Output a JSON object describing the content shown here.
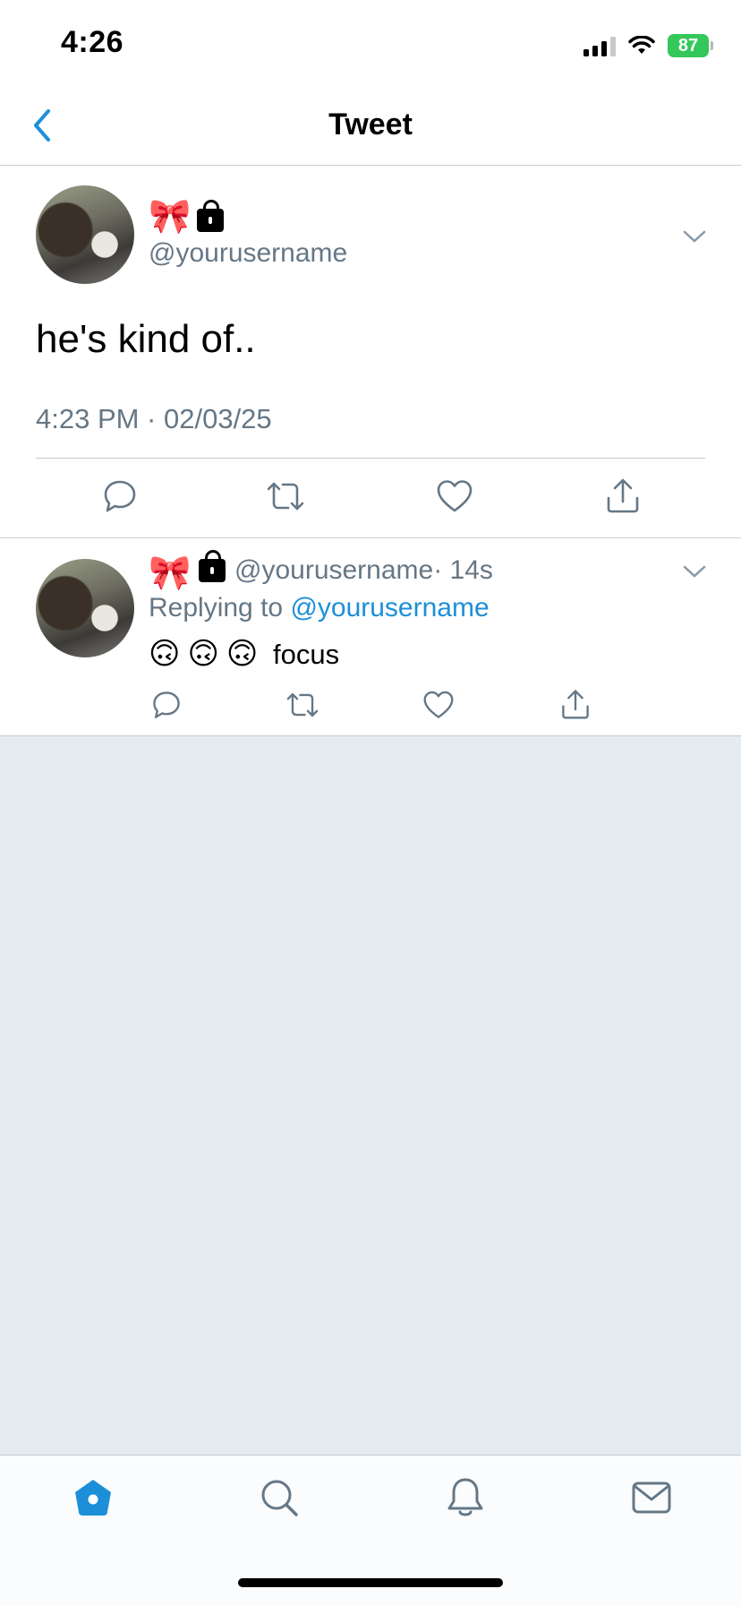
{
  "status": {
    "time": "4:26",
    "battery": "87"
  },
  "header": {
    "title": "Tweet"
  },
  "tweet": {
    "bow": "🎀",
    "handle": "@yourusername",
    "text": "he's kind of..",
    "timestamp": "4:23 PM · 02/03/25"
  },
  "reply": {
    "bow": "🎀",
    "handle": "@yourusername",
    "time": "· 14s",
    "replying_prefix": "Replying to",
    "replying_to": "@yourusername",
    "emojis": [
      "🙃",
      "🙃",
      "🙃"
    ],
    "text": "focus"
  },
  "colors": {
    "accent": "#1d8fd8",
    "muted": "#657786",
    "empty_bg": "#e6eaf1",
    "battery": "#34c759"
  },
  "icons": {
    "tabs": [
      "home-icon",
      "search-icon",
      "notifications-icon",
      "messages-icon"
    ],
    "actions": [
      "reply-icon",
      "retweet-icon",
      "like-icon",
      "share-icon"
    ]
  }
}
